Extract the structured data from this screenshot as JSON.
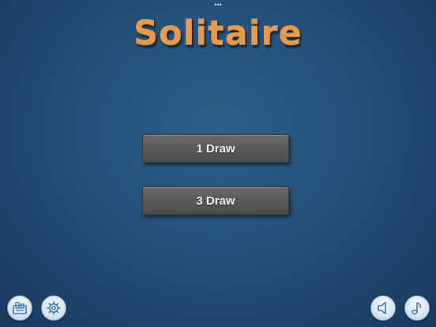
{
  "status": {
    "dots": "•••"
  },
  "title": "Solitaire",
  "menu": {
    "draw_one_label": "1 Draw",
    "draw_three_label": "3 Draw"
  },
  "bottom_bar": {
    "left_icons": [
      "stats-icon",
      "settings-gear-icon"
    ],
    "right_icons": [
      "speaker-icon",
      "music-note-icon"
    ]
  },
  "colors": {
    "background": "#24507a",
    "title": "#e79a4e",
    "button": "#595959",
    "button_text": "#f2f2f2",
    "icon": "#4a7aa8"
  }
}
